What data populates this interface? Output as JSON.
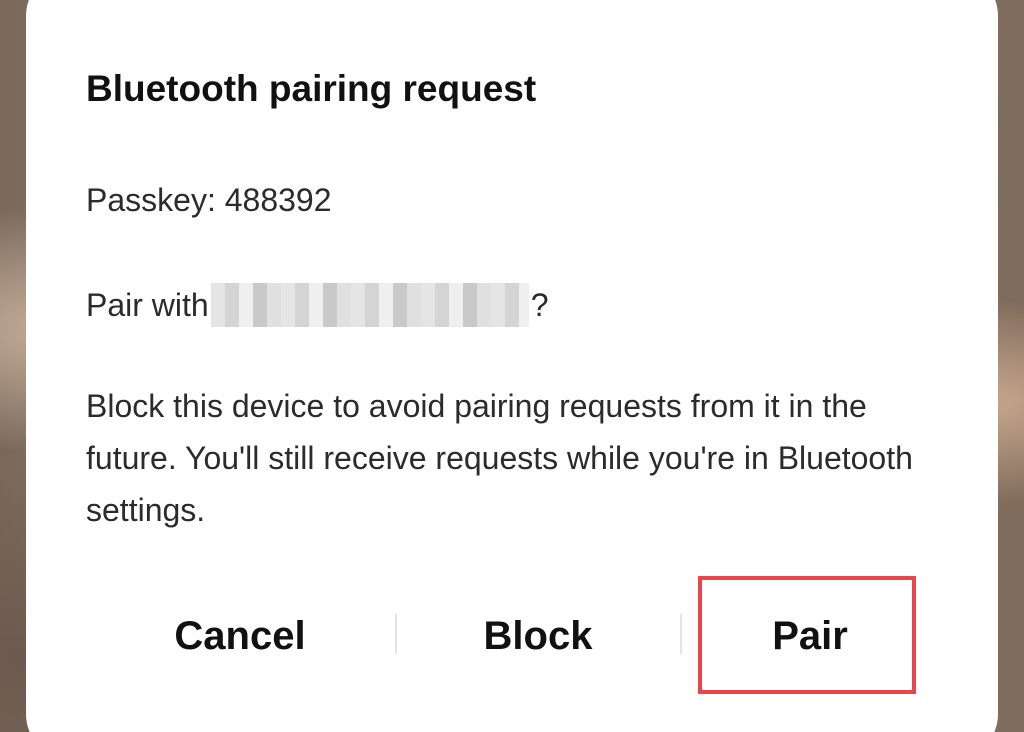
{
  "dialog": {
    "title": "Bluetooth pairing request",
    "passkey_text": "Passkey: 488392",
    "pair_with_prefix": "Pair with",
    "pair_with_suffix": "?",
    "description": "Block this device to avoid pairing requests from it in the future. You'll still receive requests while you're in Bluetooth settings."
  },
  "buttons": {
    "cancel_label": "Cancel",
    "block_label": "Block",
    "pair_label": "Pair"
  },
  "colors": {
    "dialog_background": "#ffffff",
    "highlight_border": "#e8464a",
    "text_primary": "#111111"
  }
}
